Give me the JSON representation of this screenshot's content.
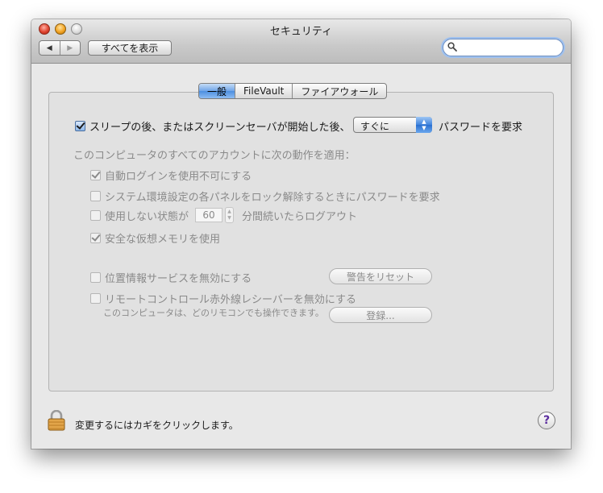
{
  "window": {
    "title": "セキュリティ"
  },
  "toolbar": {
    "back_icon": "back-arrow-icon",
    "forward_icon": "forward-arrow-icon",
    "show_all_label": "すべてを表示",
    "search_placeholder": "",
    "search_value": ""
  },
  "tabs": [
    {
      "label": "一般",
      "active": true
    },
    {
      "label": "FileVault",
      "active": false
    },
    {
      "label": "ファイアウォール",
      "active": false
    }
  ],
  "general": {
    "require_password_prefix": "スリープの後、またはスクリーンセーバが開始した後、",
    "require_password_checked": true,
    "require_password_delay": "すぐに",
    "require_password_suffix": "パスワードを要求",
    "section_heading": "このコンピュータのすべてのアカウントに次の動作を適用：",
    "disable_auto_login": {
      "label": "自動ログインを使用不可にする",
      "checked": true
    },
    "require_password_unlock_panes": {
      "label": "システム環境設定の各パネルをロック解除するときにパスワードを要求",
      "checked": false
    },
    "logout_after_inactivity": {
      "label_before": "使用しない状態が",
      "minutes": "60",
      "label_after": "分間続いたらログアウト",
      "checked": false
    },
    "secure_virtual_memory": {
      "label": "安全な仮想メモリを使用",
      "checked": true
    },
    "disable_location_services": {
      "label": "位置情報サービスを無効にする",
      "checked": false
    },
    "reset_warnings_label": "警告をリセット",
    "disable_ir_receiver": {
      "label": "リモートコントロール赤外線レシーバーを無効にする",
      "checked": false
    },
    "ir_note": "このコンピュータは、どのリモコンでも操作できます。",
    "pair_label": "登録..."
  },
  "footer": {
    "lock_text": "変更するにはカギをクリックします。",
    "help_label": "?"
  },
  "colors": {
    "accent": "#4d8fe0",
    "window_bg": "#e8e8e8",
    "panel_bg": "#e1e1e1",
    "disabled_text": "#8a8a8a"
  }
}
